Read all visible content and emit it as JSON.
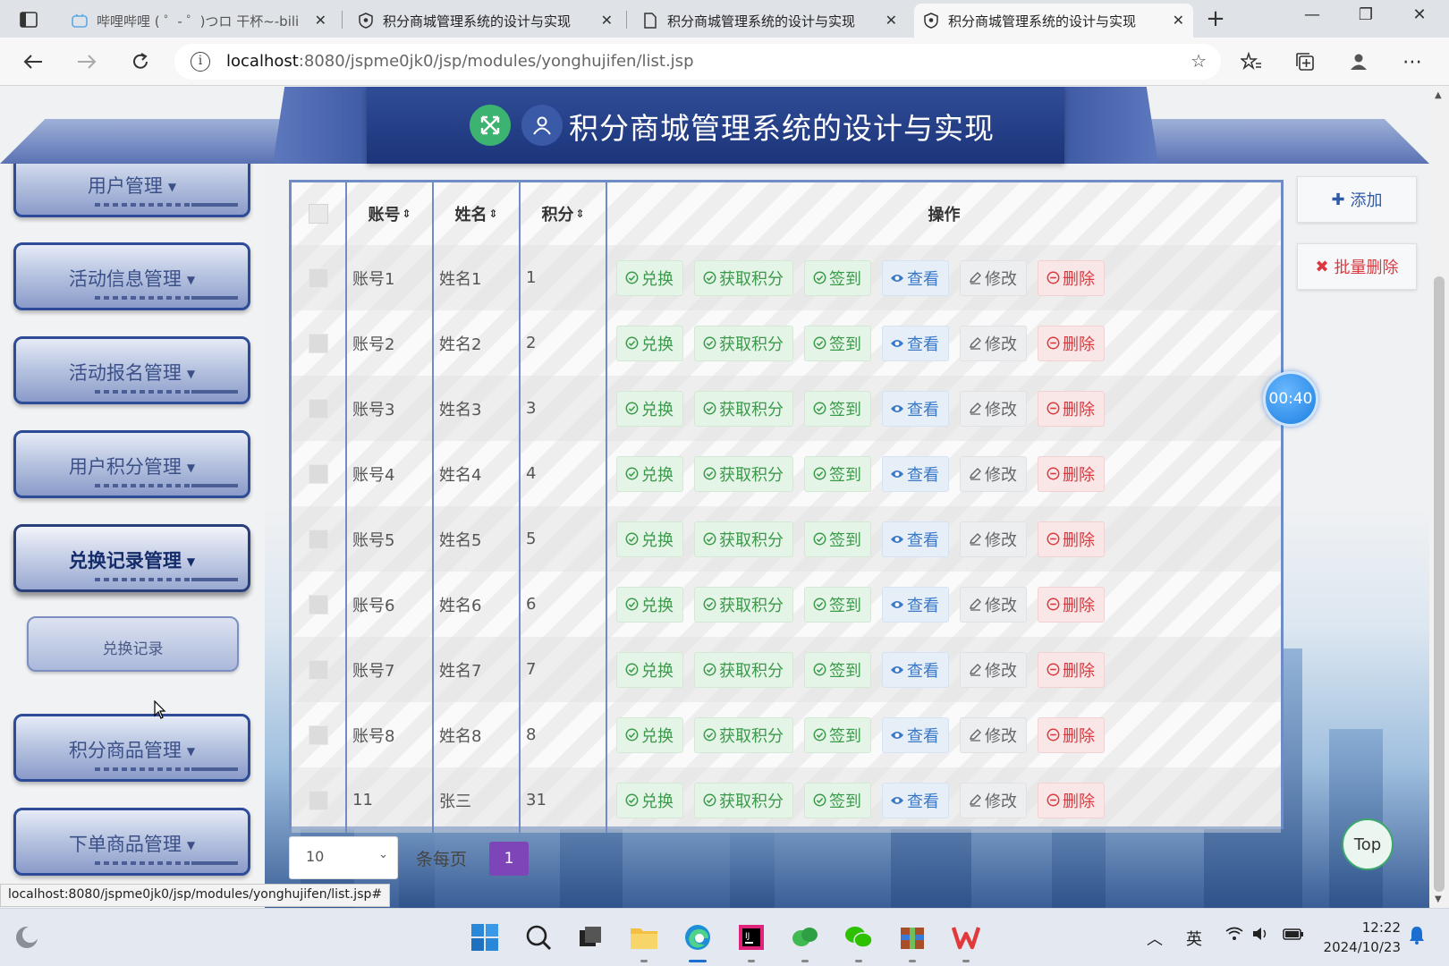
{
  "browser": {
    "tabs": [
      {
        "title": "哔哩哔哩 ( ゜- ゜)つロ 干杯~-bilibili",
        "active": false
      },
      {
        "title": "积分商城管理系统的设计与实现",
        "active": false
      },
      {
        "title": "积分商城管理系统的设计与实现",
        "active": false
      },
      {
        "title": "积分商城管理系统的设计与实现",
        "active": true
      }
    ],
    "url_host": "localhost",
    "url_path": ":8080/jspme0jk0/jsp/modules/yonghujifen/list.jsp",
    "status_url": "localhost:8080/jspme0jk0/jsp/modules/yonghujifen/list.jsp#"
  },
  "header": {
    "title": "积分商城管理系统的设计与实现"
  },
  "sidebar": {
    "items": [
      {
        "label": "用户管理",
        "active": false
      },
      {
        "label": "活动信息管理",
        "active": false
      },
      {
        "label": "活动报名管理",
        "active": false
      },
      {
        "label": "用户积分管理",
        "active": false
      },
      {
        "label": "兑换记录管理",
        "active": true
      },
      {
        "label": "积分商品管理",
        "active": false
      },
      {
        "label": "下单商品管理",
        "active": false
      }
    ],
    "submenu": {
      "label": "兑换记录"
    }
  },
  "table": {
    "columns": [
      "账号",
      "姓名",
      "积分",
      "操作"
    ],
    "sort_icon": "⇕",
    "rows": [
      {
        "account": "账号1",
        "name": "姓名1",
        "points": "1"
      },
      {
        "account": "账号2",
        "name": "姓名2",
        "points": "2"
      },
      {
        "account": "账号3",
        "name": "姓名3",
        "points": "3"
      },
      {
        "account": "账号4",
        "name": "姓名4",
        "points": "4"
      },
      {
        "account": "账号5",
        "name": "姓名5",
        "points": "5"
      },
      {
        "account": "账号6",
        "name": "姓名6",
        "points": "6"
      },
      {
        "account": "账号7",
        "name": "姓名7",
        "points": "7"
      },
      {
        "account": "账号8",
        "name": "姓名8",
        "points": "8"
      },
      {
        "account": "11",
        "name": "张三",
        "points": "31"
      }
    ],
    "actions": [
      {
        "label": "兑换",
        "style": "green",
        "icon": "check-circle-icon"
      },
      {
        "label": "获取积分",
        "style": "green",
        "icon": "check-circle-icon"
      },
      {
        "label": "签到",
        "style": "green",
        "icon": "check-circle-icon"
      },
      {
        "label": "查看",
        "style": "blue",
        "icon": "eye-icon"
      },
      {
        "label": "修改",
        "style": "gray",
        "icon": "edit-icon"
      },
      {
        "label": "删除",
        "style": "red",
        "icon": "minus-circle-icon"
      }
    ]
  },
  "toolbar": {
    "add_label": "添加",
    "batch_delete_label": "批量删除"
  },
  "timer": "00:40",
  "top_label": "Top",
  "pager": {
    "page_size": "10",
    "per_page_label": "条每页",
    "current_page": "1"
  },
  "taskbar": {
    "lang": "英",
    "time": "12:22",
    "date": "2024/10/23"
  },
  "colors": {
    "header_blue": "#1c347a",
    "table_border": "#6f8cc7",
    "action_green": "#3a9a4a",
    "action_blue": "#3a78c8",
    "action_red": "#d9393f",
    "page_active": "#7e45b8"
  }
}
